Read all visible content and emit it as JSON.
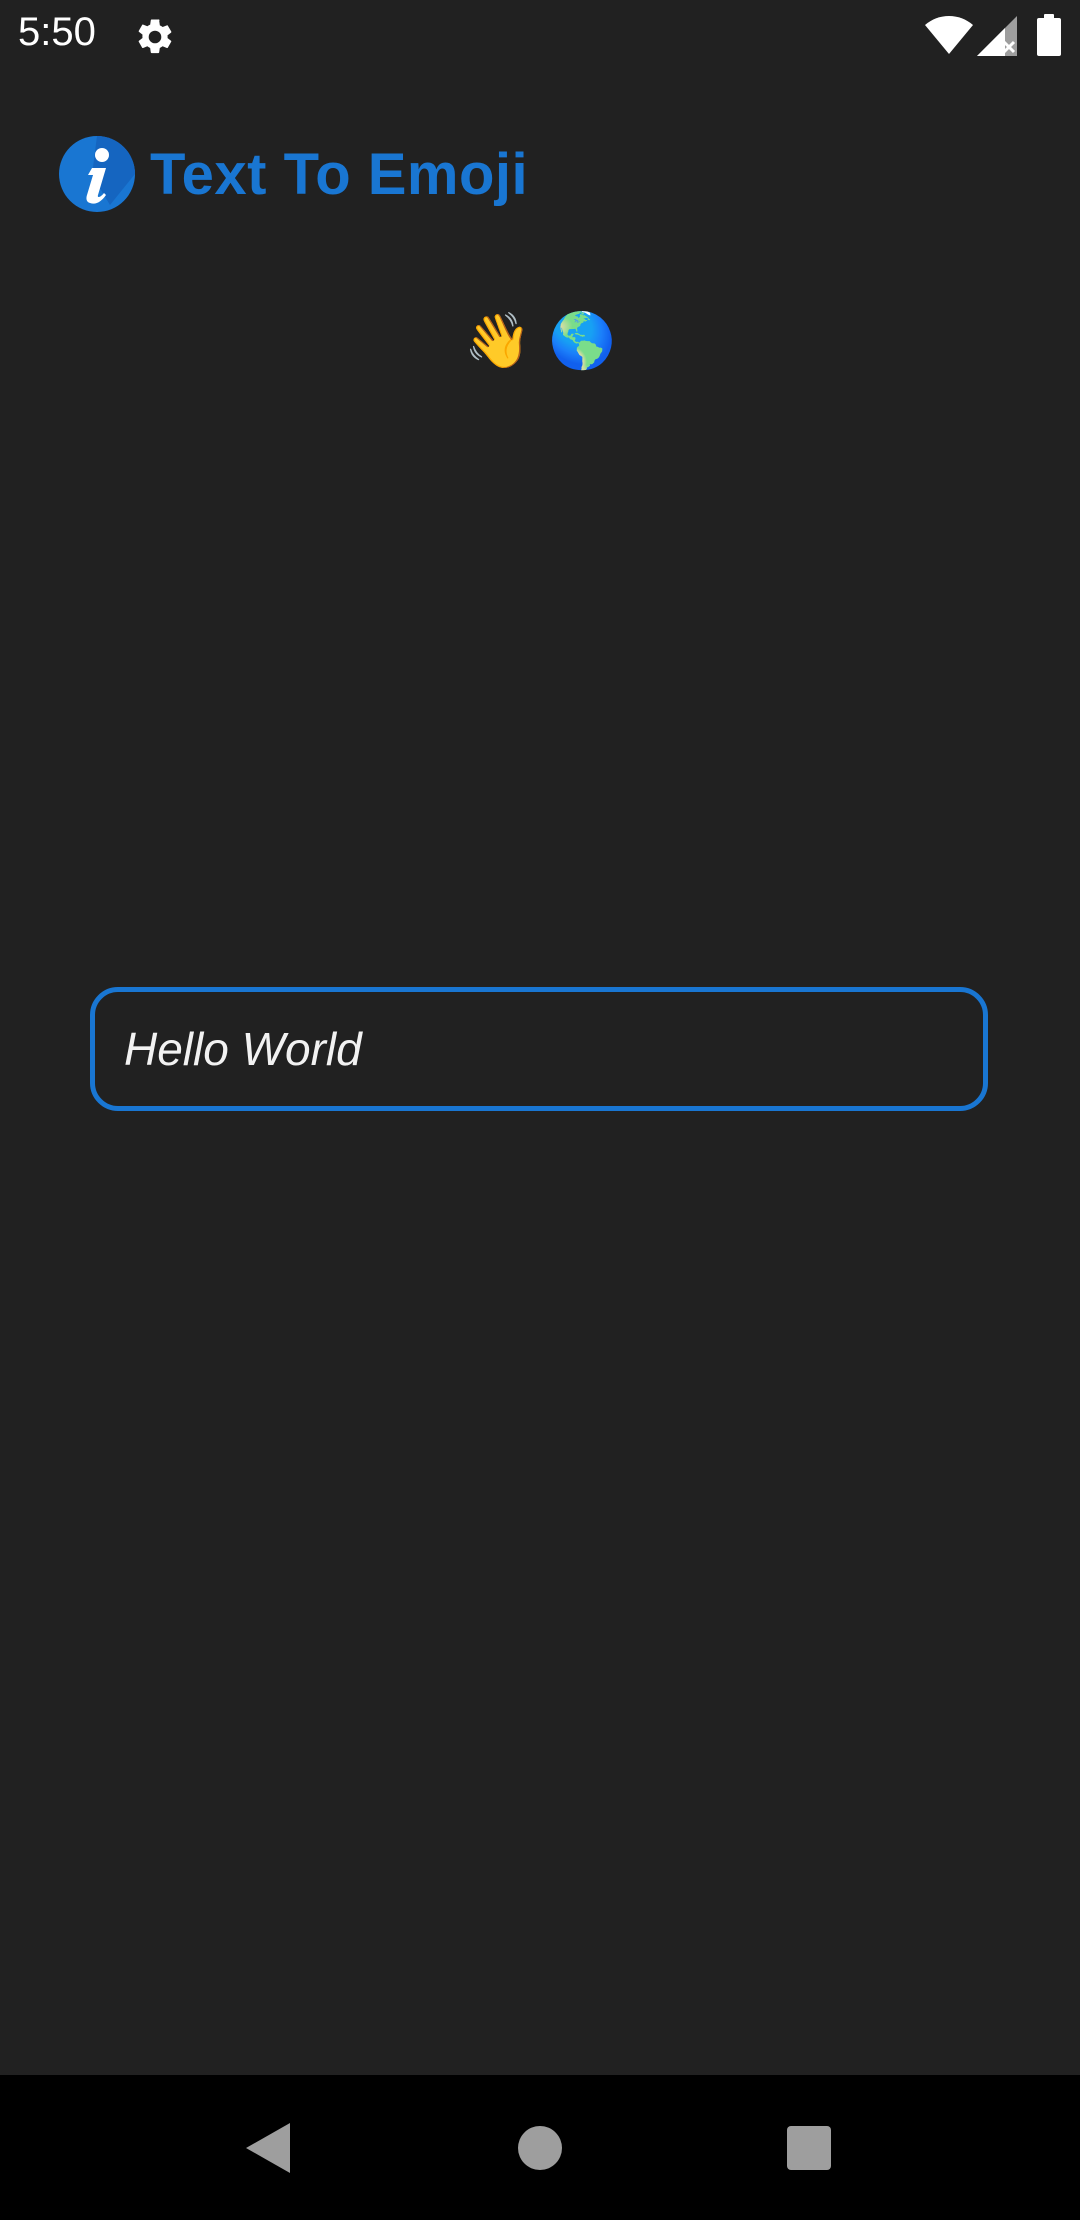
{
  "status_bar": {
    "time": "5:50",
    "icons": [
      "gear-icon",
      "wifi-icon",
      "signal-icon",
      "battery-icon"
    ]
  },
  "app": {
    "title": "Text To Emoji",
    "logo_icon": "info-icon",
    "accent_color": "#1976d2",
    "background_color": "#212121"
  },
  "output": {
    "emoji_text": "👋 🌎"
  },
  "input": {
    "value": "Hello World"
  },
  "nav_bar": {
    "buttons": [
      "back-icon",
      "home-icon",
      "recents-icon"
    ]
  }
}
